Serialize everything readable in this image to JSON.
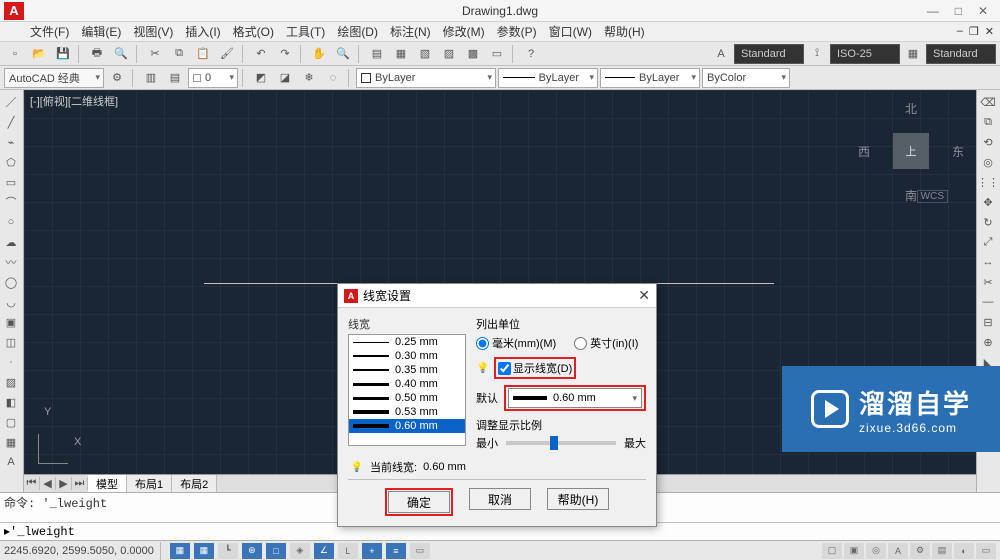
{
  "title": "Drawing1.dwg",
  "menus": [
    "文件(F)",
    "编辑(E)",
    "视图(V)",
    "插入(I)",
    "格式(O)",
    "工具(T)",
    "绘图(D)",
    "标注(N)",
    "修改(M)",
    "参数(P)",
    "窗口(W)",
    "帮助(H)"
  ],
  "workspace": "AutoCAD 经典",
  "layerDrop": "ByLayer",
  "ltDrop": "ByLayer",
  "lwDrop": "ByLayer",
  "colorDrop": "ByColor",
  "left0": "0",
  "styleStd": "Standard",
  "styleIso": "ISO-25",
  "viewportLabel": "[-][俯视][二维线框]",
  "viewcube": {
    "top": "上",
    "n": "北",
    "s": "南",
    "w": "西",
    "e": "东",
    "wcs": "WCS"
  },
  "ucs": {
    "x": "X",
    "y": "Y"
  },
  "tabs": {
    "model": "模型",
    "layout1": "布局1",
    "layout2": "布局2"
  },
  "dialog": {
    "title": "线宽设置",
    "lwLabel": "线宽",
    "items": [
      {
        "t": "0.25 mm",
        "h": 1
      },
      {
        "t": "0.30 mm",
        "h": 2
      },
      {
        "t": "0.35 mm",
        "h": 2
      },
      {
        "t": "0.40 mm",
        "h": 3
      },
      {
        "t": "0.50 mm",
        "h": 3
      },
      {
        "t": "0.53 mm",
        "h": 4
      },
      {
        "t": "0.60 mm",
        "h": 4,
        "sel": true
      }
    ],
    "unitsLabel": "列出单位",
    "mm": "毫米(mm)(M)",
    "in": "英寸(in)(I)",
    "showLw": "显示线宽(D)",
    "defaultLabel": "默认",
    "defaultVal": "0.60 mm",
    "scaleLabel": "调整显示比例",
    "min": "最小",
    "max": "最大",
    "currentLabel": "当前线宽:",
    "currentVal": "0.60 mm",
    "ok": "确定",
    "cancel": "取消",
    "help": "帮助(H)"
  },
  "cmd": {
    "prev": "命令: '_lweight",
    "prompt": "▸'_lweight"
  },
  "status": {
    "coords": "2245.6920, 2599.5050, 0.0000"
  },
  "watermark": {
    "big": "溜溜自学",
    "small": "zixue.3d66.com"
  }
}
